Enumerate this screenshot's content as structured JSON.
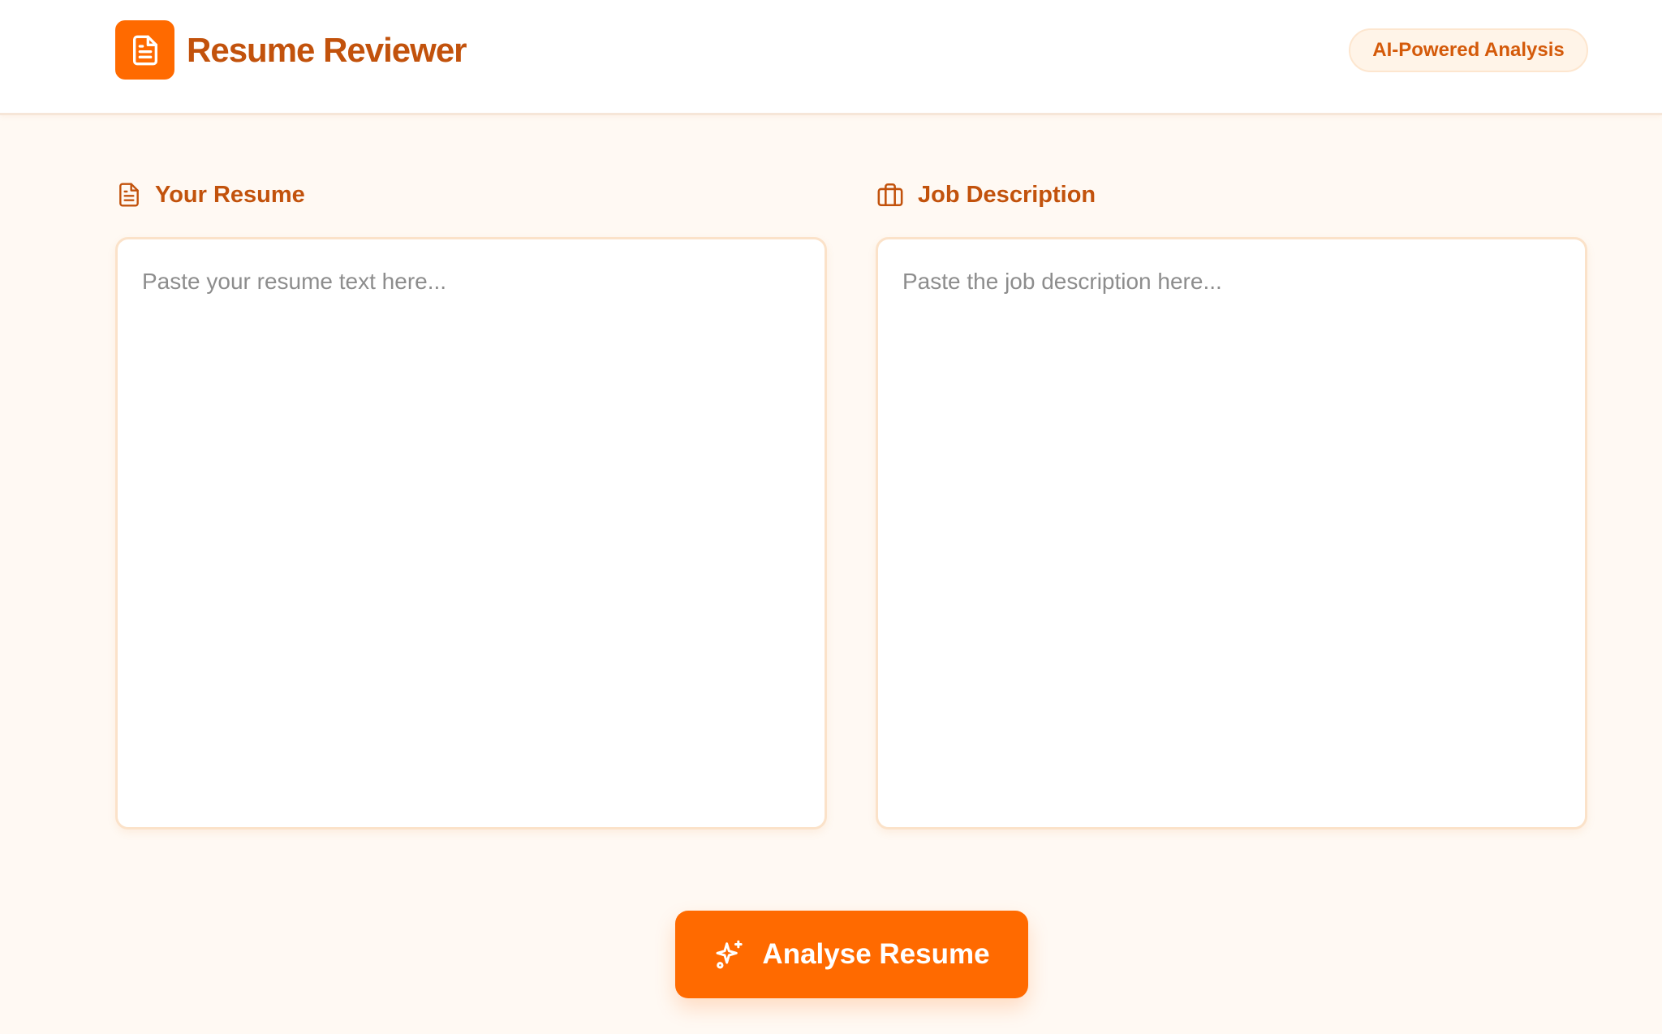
{
  "header": {
    "title": "Resume Reviewer",
    "logo_icon": "document-icon",
    "badge": "AI-Powered Analysis"
  },
  "resume_section": {
    "label": "Your Resume",
    "icon": "document-icon",
    "placeholder": "Paste your resume text here...",
    "value": ""
  },
  "job_section": {
    "label": "Job Description",
    "icon": "briefcase-icon",
    "placeholder": "Paste the job description here...",
    "value": ""
  },
  "action": {
    "label": "Analyse Resume",
    "icon": "sparkles-icon"
  },
  "colors": {
    "accent": "#ff6a00",
    "title_text": "#c2520c",
    "page_background": "#fff9f3",
    "panel_border": "#fbe2c9",
    "placeholder_text": "#8d8d8d"
  }
}
